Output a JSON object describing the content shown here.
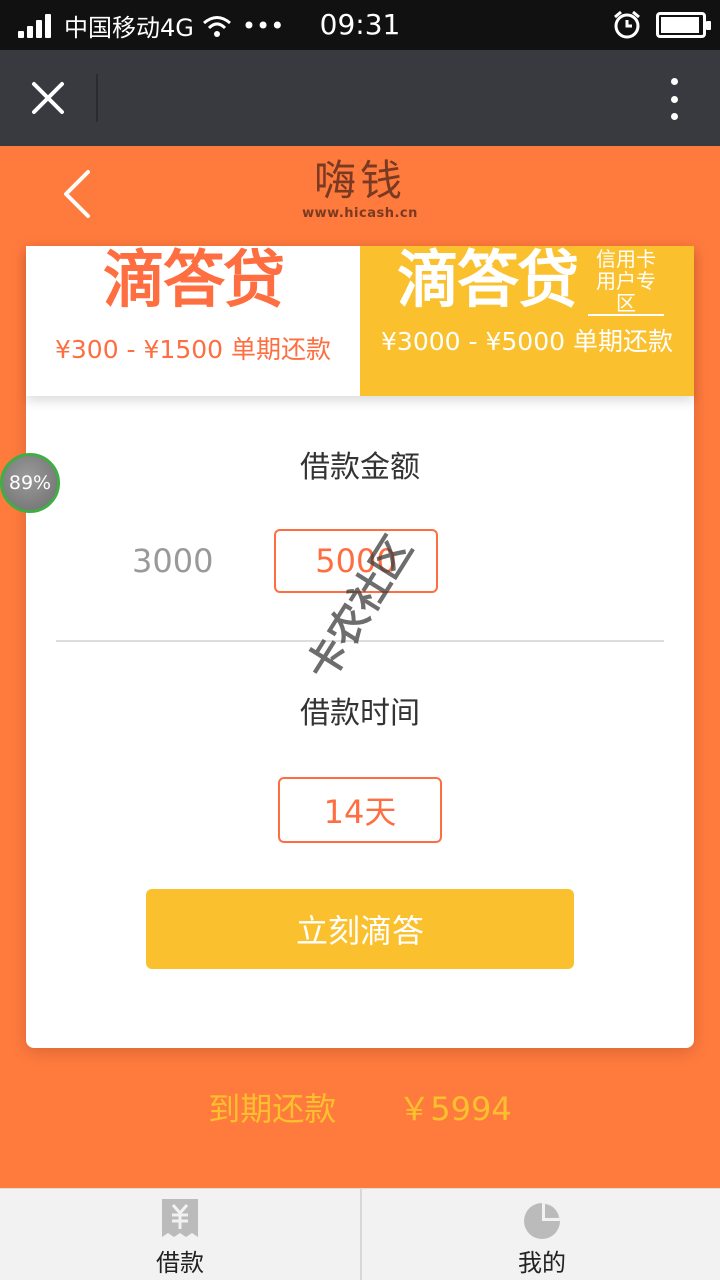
{
  "status_bar": {
    "carrier": "中国移动4G",
    "dots": "•••",
    "time": "09:31"
  },
  "header": {
    "logo_text": "嗨钱",
    "logo_url": "www.hicash.cn"
  },
  "products": [
    {
      "name": "滴答贷",
      "range": "¥300 - ¥1500 单期还款",
      "tag": ""
    },
    {
      "name": "滴答贷",
      "range": "¥3000 - ¥5000 单期还款",
      "tag": "信用卡用户专区"
    }
  ],
  "loan": {
    "amount_title": "借款金额",
    "amount_option_1": "3000",
    "amount_selected": "5000",
    "time_title": "借款时间",
    "time_selected": "14天",
    "submit_label": "立刻滴答"
  },
  "due": {
    "label": "到期还款",
    "amount": "￥5994"
  },
  "tabs": [
    {
      "label": "借款",
      "icon": "yuan-receipt-icon"
    },
    {
      "label": "我的",
      "icon": "pie-chart-icon"
    }
  ],
  "overlay": {
    "progress_badge": "89%",
    "watermark": "卡农社区"
  },
  "colors": {
    "brand_orange": "#ff7a3d",
    "accent_yellow": "#fbc02d",
    "browser_bar": "#393a3f"
  }
}
